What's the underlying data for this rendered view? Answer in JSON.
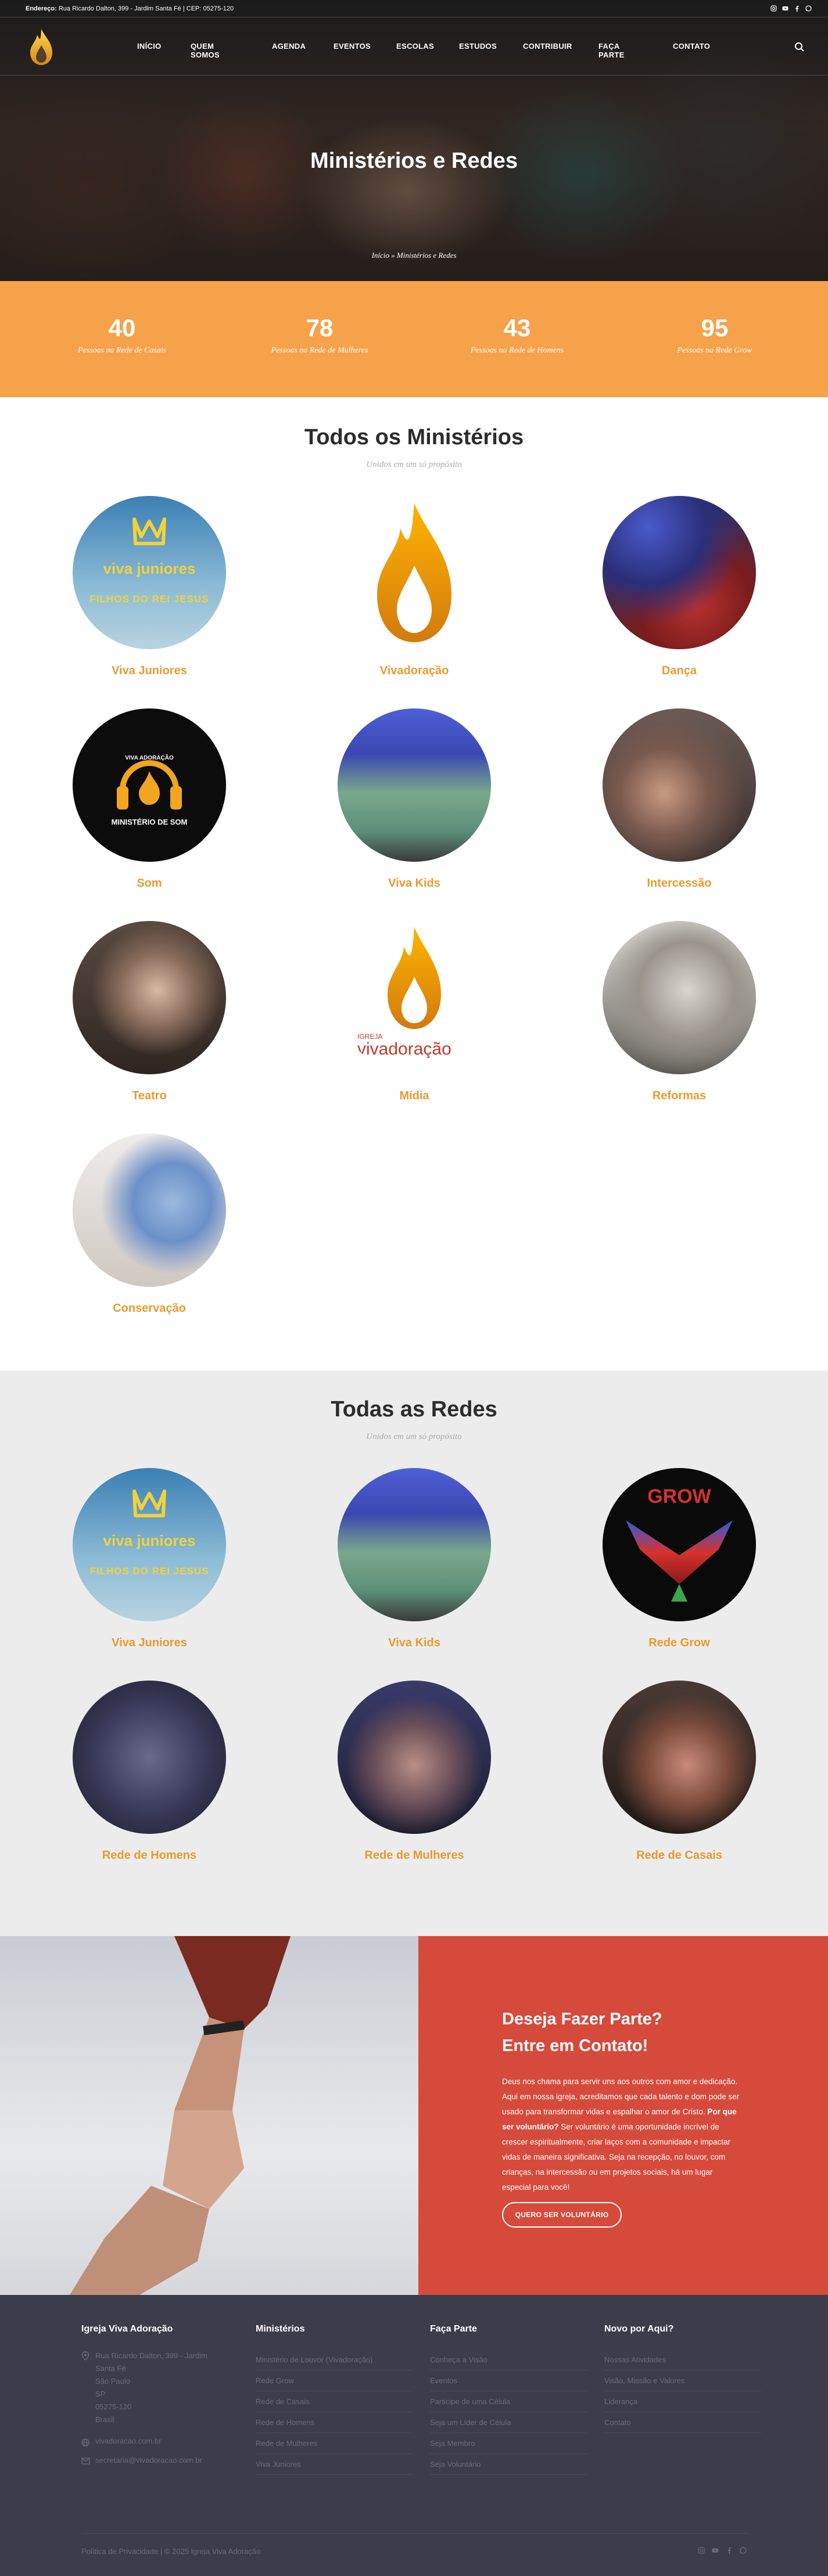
{
  "topbar": {
    "address_label": "Endereço:",
    "address": "Rua Ricardo Dalton, 399 - Jardim Santa Fé | CEP: 05275-120",
    "social": [
      "instagram-icon",
      "youtube-icon",
      "facebook-icon",
      "whatsapp-icon"
    ]
  },
  "nav": {
    "items": [
      "INÍCIO",
      "QUEM SOMOS",
      "AGENDA",
      "EVENTOS",
      "ESCOLAS",
      "ESTUDOS",
      "CONTRIBUIR",
      "FAÇA PARTE",
      "CONTATO"
    ]
  },
  "hero": {
    "title": "Ministérios e Redes",
    "breadcrumb": "Início » Ministérios e Redes"
  },
  "stats": [
    {
      "value": "40",
      "label": "Pessoas na Rede de Casais"
    },
    {
      "value": "78",
      "label": "Pessoas na Rede de Mulheres"
    },
    {
      "value": "43",
      "label": "Pessoas na Rede de Homens"
    },
    {
      "value": "95",
      "label": "Pessoas na Rede Grow"
    }
  ],
  "ministries": {
    "title": "Todos os Ministérios",
    "subtitle": "Unidos em um só propósito",
    "items": [
      {
        "label": "Viva Juniores",
        "image_text": "viva juniores",
        "image_text2": "FILHOS DO REI JESUS"
      },
      {
        "label": "Vivadoração"
      },
      {
        "label": "Dança"
      },
      {
        "label": "Som",
        "image_text": "VIVA ADORAÇÃO",
        "image_text2": "MINISTÉRIO DE SOM"
      },
      {
        "label": "Viva Kids"
      },
      {
        "label": "Intercessão"
      },
      {
        "label": "Teatro"
      },
      {
        "label": "Mídia",
        "image_text": "IGREJA",
        "image_text2": "vivadoração"
      },
      {
        "label": "Reformas"
      },
      {
        "label": "Conservação"
      }
    ]
  },
  "networks": {
    "title": "Todas as Redes",
    "subtitle": "Unidos em um só propósito",
    "items": [
      {
        "label": "Viva Juniores",
        "image_text": "viva juniores",
        "image_text2": "FILHOS DO REI JESUS"
      },
      {
        "label": "Viva Kids"
      },
      {
        "label": "Rede Grow",
        "image_text": "GROW"
      },
      {
        "label": "Rede de Homens"
      },
      {
        "label": "Rede de Mulheres"
      },
      {
        "label": "Rede de Casais"
      }
    ]
  },
  "cta": {
    "title_line1": "Deseja Fazer Parte?",
    "title_line2": "Entre em Contato!",
    "text_before": "Deus nos chama para servir uns aos outros com amor e dedicação. Aqui em nossa igreja, acreditamos que cada talento e dom pode ser usado para transformar vidas e espalhar o amor de Cristo. ",
    "text_bold": "Por que ser voluntário?",
    "text_after": " Ser voluntário é uma oportunidade incrível de crescer espiritualmente, criar laços com a comunidade e impactar vidas de maneira significativa. Seja na recepção, no louvor, com crianças, na intercessão ou em projetos sociais, há um lugar especial para você!",
    "button": "QUERO SER VOLUNTÁRIO"
  },
  "footer": {
    "col1": {
      "title": "Igreja Viva Adoração",
      "address_lines": [
        "Rua Ricardo Dalton, 399 - Jardim",
        "Santa Fé",
        "São Paulo",
        "SP",
        "05275-120",
        "Brasil"
      ],
      "website": "vivadoracao.com.br",
      "email": "secretaria@vivadoracao.com.br"
    },
    "col2": {
      "title": "Ministérios",
      "links": [
        "Ministério de Louvor (Vivadoração)",
        "Rede Grow",
        "Rede de Casais",
        "Rede de Homens",
        "Rede de Mulheres",
        "Viva Juniores"
      ]
    },
    "col3": {
      "title": "Faça Parte",
      "links": [
        "Conheça a Visão",
        "Eventos",
        "Participe de uma Célula",
        "Seja um Líder de Célula",
        "Seja Membro",
        "Seja Voluntário"
      ]
    },
    "col4": {
      "title": "Novo por Aqui?",
      "links": [
        "Nossas Atividades",
        "Visão, Missão e Valores",
        "Liderança",
        "Contato"
      ]
    },
    "copyright": "Política de Privacidade | © 2025 Igreja Viva Adoração",
    "social": [
      "instagram-icon",
      "youtube-icon",
      "facebook-icon",
      "whatsapp-icon"
    ]
  },
  "colors": {
    "accent_orange": "#f6a24b",
    "label_orange": "#e89a2e",
    "cta_red": "#d64a3c",
    "footer_bg": "#3c3d4a"
  }
}
